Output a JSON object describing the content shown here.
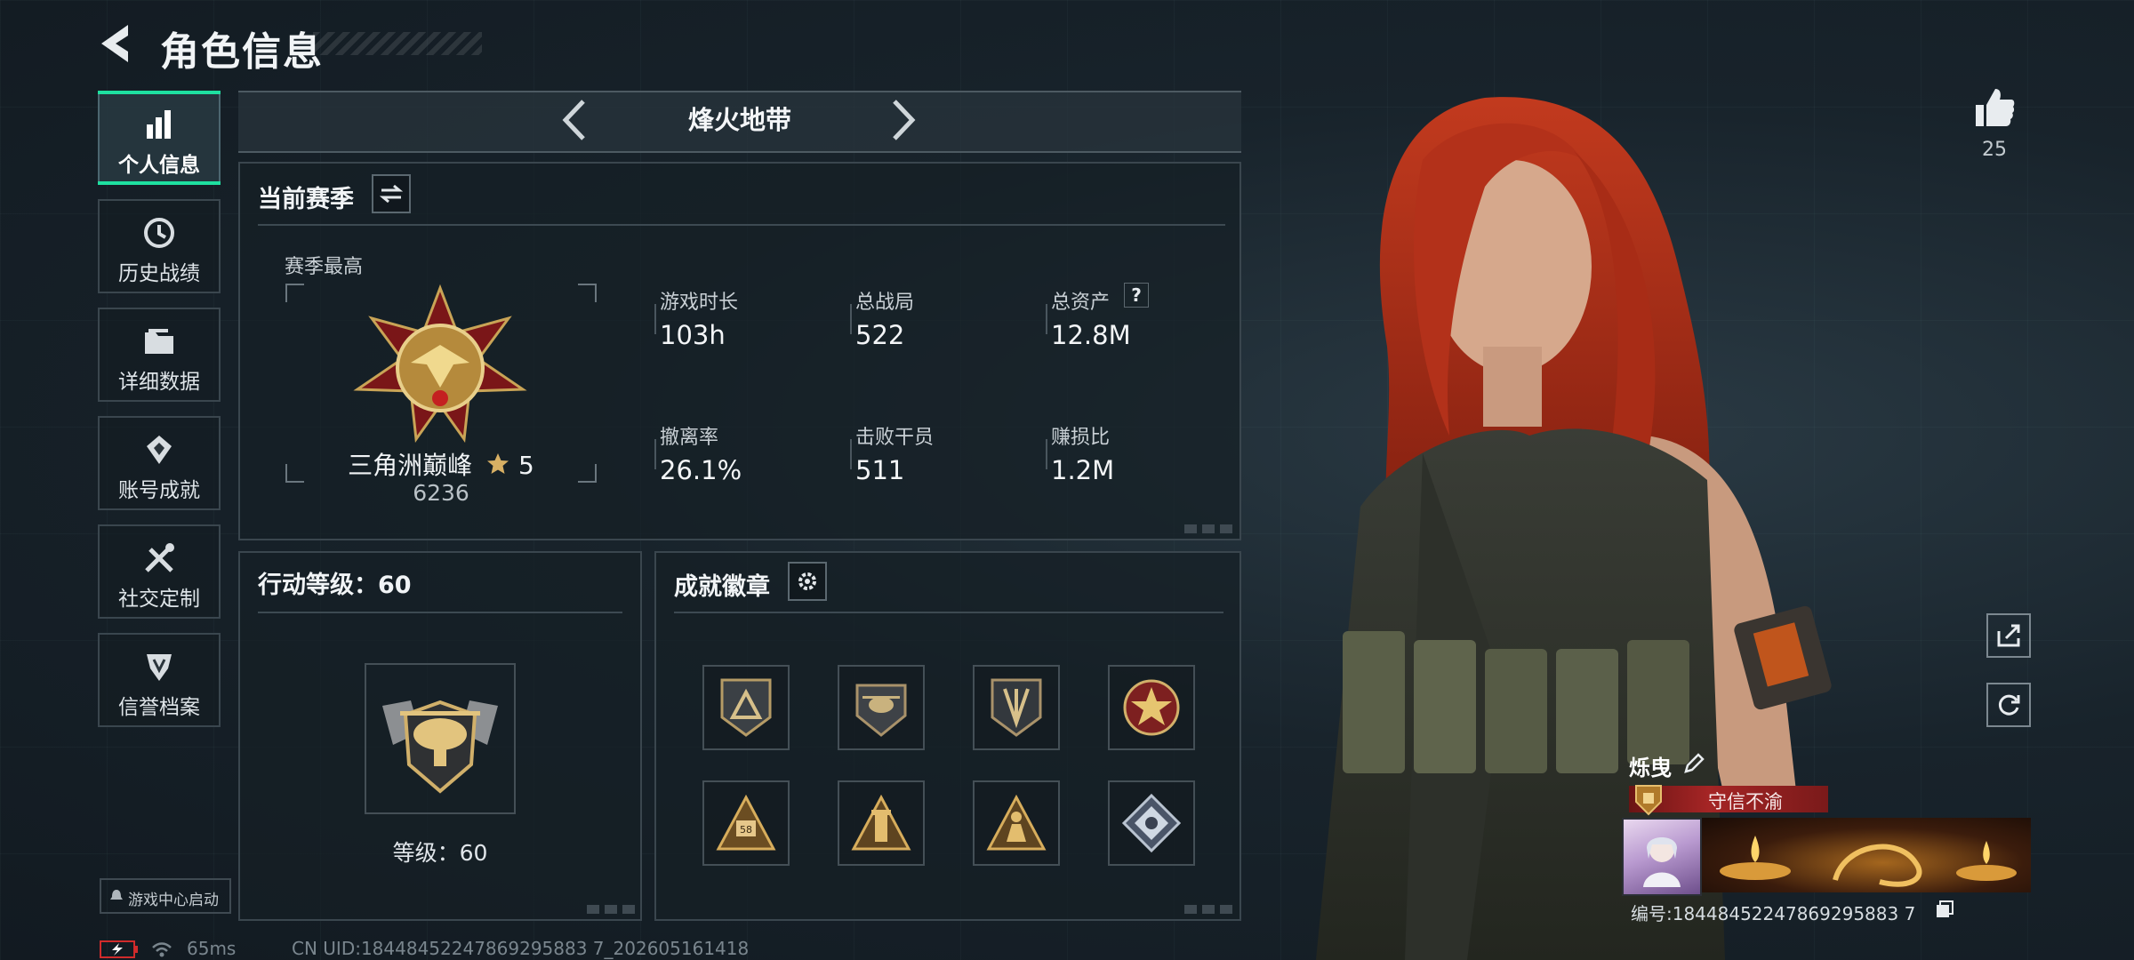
{
  "header": {
    "title": "角色信息"
  },
  "sidebar": {
    "items": [
      {
        "label": "个人信息",
        "icon": "bar-chart-icon",
        "active": true
      },
      {
        "label": "历史战绩",
        "icon": "history-icon",
        "active": false
      },
      {
        "label": "详细数据",
        "icon": "folder-icon",
        "active": false
      },
      {
        "label": "账号成就",
        "icon": "achievement-icon",
        "active": false
      },
      {
        "label": "社交定制",
        "icon": "tools-icon",
        "active": false
      },
      {
        "label": "信誉档案",
        "icon": "shield-icon",
        "active": false
      }
    ],
    "game_center": "游戏中心启动"
  },
  "mode": {
    "label": "烽火地带"
  },
  "season": {
    "title": "当前赛季",
    "best_label": "赛季最高",
    "rank_name": "三角洲巅峰",
    "rank_stars": "5",
    "rank_score": "6236",
    "stats": [
      {
        "label": "游戏时长",
        "value": "103h"
      },
      {
        "label": "总战局",
        "value": "522"
      },
      {
        "label": "总资产",
        "value": "12.8M",
        "help": "?"
      },
      {
        "label": "撤离率",
        "value": "26.1%"
      },
      {
        "label": "击败干员",
        "value": "511"
      },
      {
        "label": "赚损比",
        "value": "1.2M"
      }
    ]
  },
  "level": {
    "title": "行动等级：60",
    "caption": "等级：60"
  },
  "badges": {
    "title": "成就徽章",
    "items": [
      "triangle-badge-icon",
      "helicopter-badge-icon",
      "blades-badge-icon",
      "star-emblem-badge-icon",
      "pyramid-58-badge-icon",
      "tower-badge-icon",
      "soldier-badge-icon",
      "diamond-badge-icon"
    ]
  },
  "likes": {
    "count": "25"
  },
  "player": {
    "name": "烁曳",
    "motto": "守信不渝",
    "id_text": "编号:18448452247869295883 7"
  },
  "status": {
    "ping": "65ms",
    "uid": "CN UID:18448452247869295883 7_202605161418"
  },
  "colors": {
    "accent": "#1ee0a0",
    "banner": "#8b1d1d"
  }
}
